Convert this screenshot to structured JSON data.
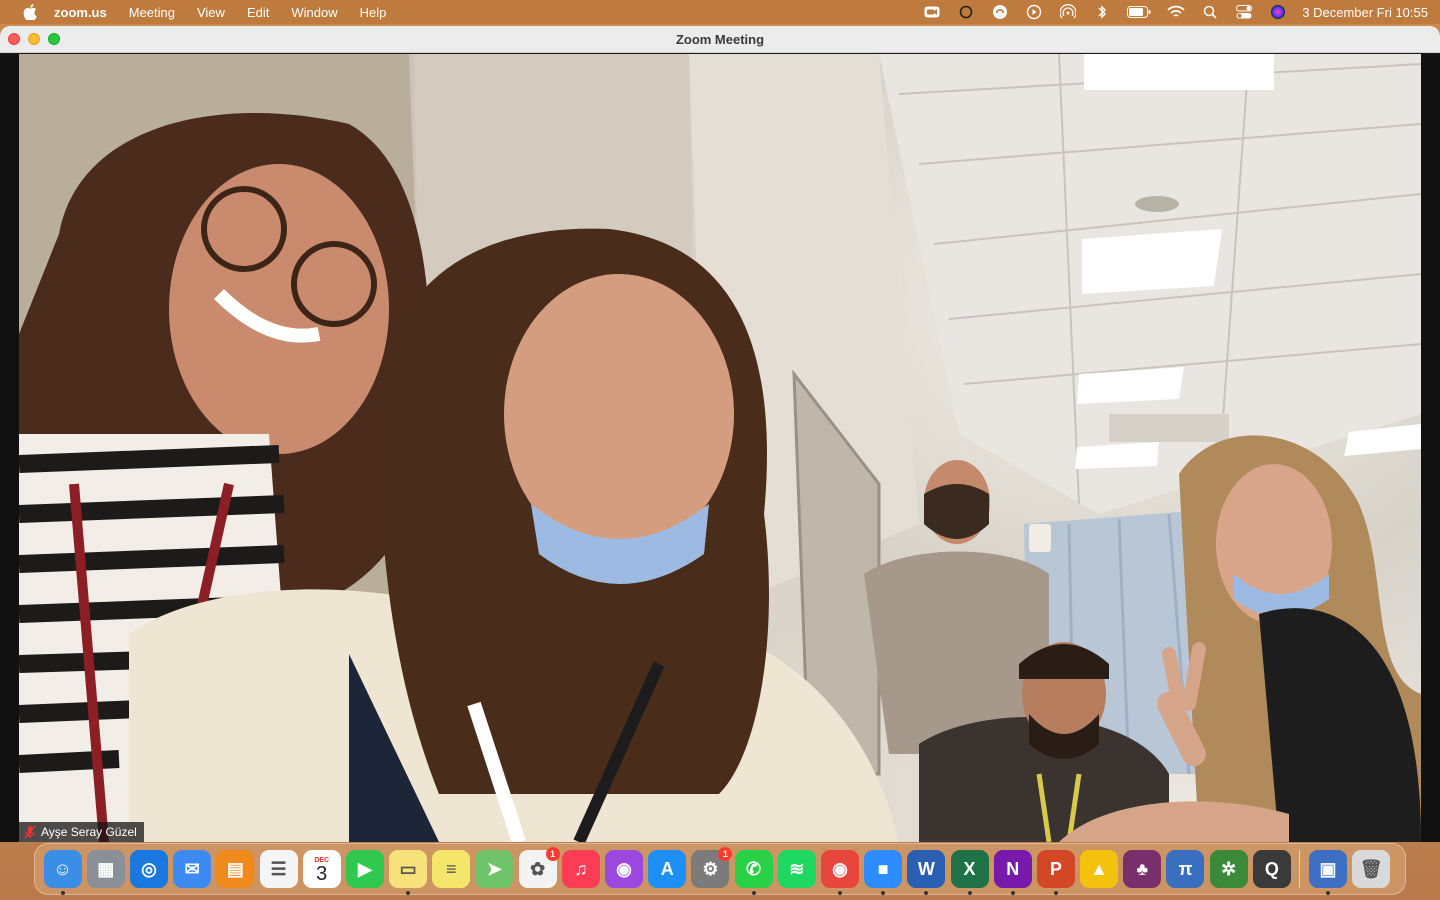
{
  "menubar": {
    "apple_icon": "apple-logo-icon",
    "items": [
      "zoom.us",
      "Meeting",
      "View",
      "Edit",
      "Window",
      "Help"
    ],
    "status_icons": [
      "zoom-video-icon",
      "circle-icon",
      "creative-cloud-icon",
      "play-icon",
      "airdrop-icon",
      "bluetooth-icon",
      "battery-icon",
      "wifi-icon",
      "search-icon",
      "control-center-icon",
      "siri-icon"
    ],
    "clock": "3 December Fri  10:55"
  },
  "window": {
    "title": "Zoom Meeting",
    "participant_name": "Ayşe Seray Güzel",
    "mic_icon": "mic-muted-icon"
  },
  "dock": {
    "items": [
      {
        "name": "finder",
        "color": "#3a8ee6",
        "glyph": "☺",
        "running": true
      },
      {
        "name": "launchpad",
        "color": "#8a8f98",
        "glyph": "▦",
        "running": false
      },
      {
        "name": "safari",
        "color": "#1b78e0",
        "glyph": "◎",
        "running": false
      },
      {
        "name": "mail",
        "color": "#3d8bf2",
        "glyph": "✉",
        "running": false
      },
      {
        "name": "books",
        "color": "#f08a1c",
        "glyph": "▤",
        "running": false
      },
      {
        "name": "reminders",
        "color": "#f5f5f5",
        "glyph": "☰",
        "running": false
      },
      {
        "name": "calendar",
        "color": "#ffffff",
        "month": "DEC",
        "day": "3",
        "running": false
      },
      {
        "name": "facetime",
        "color": "#2fc94f",
        "glyph": "▶",
        "running": false
      },
      {
        "name": "notes",
        "color": "#f7e27a",
        "glyph": "▭",
        "running": true
      },
      {
        "name": "stickies",
        "color": "#f4e56b",
        "glyph": "≡",
        "running": false
      },
      {
        "name": "maps",
        "color": "#6fc46a",
        "glyph": "➤",
        "running": false
      },
      {
        "name": "photos",
        "color": "#f3f3f3",
        "glyph": "✿",
        "badge": "1",
        "running": false
      },
      {
        "name": "music",
        "color": "#fa3c55",
        "glyph": "♫",
        "running": false
      },
      {
        "name": "podcasts",
        "color": "#9b47e0",
        "glyph": "◉",
        "running": false
      },
      {
        "name": "app-store",
        "color": "#1e8ff5",
        "glyph": "A",
        "running": false
      },
      {
        "name": "system-preferences",
        "color": "#7b7b7b",
        "glyph": "⚙",
        "badge": "1",
        "running": false
      },
      {
        "name": "whatsapp",
        "color": "#28d146",
        "glyph": "✆",
        "running": true
      },
      {
        "name": "spotify",
        "color": "#1ed760",
        "glyph": "≋",
        "running": false
      },
      {
        "name": "chrome",
        "color": "#e8453c",
        "glyph": "◉",
        "running": true
      },
      {
        "name": "zoom",
        "color": "#2d8cff",
        "glyph": "■",
        "running": true
      },
      {
        "name": "word",
        "color": "#2b5fb4",
        "glyph": "W",
        "running": true
      },
      {
        "name": "excel",
        "color": "#1e7245",
        "glyph": "X",
        "running": true
      },
      {
        "name": "onenote",
        "color": "#7719aa",
        "glyph": "N",
        "running": true
      },
      {
        "name": "powerpoint",
        "color": "#d24726",
        "glyph": "P",
        "running": true
      },
      {
        "name": "google-drive",
        "color": "#f4c20d",
        "glyph": "▲",
        "running": false
      },
      {
        "name": "tree-app",
        "color": "#7a2f6d",
        "glyph": "♣",
        "running": false
      },
      {
        "name": "mathtype",
        "color": "#3a6fc0",
        "glyph": "π",
        "running": false
      },
      {
        "name": "molecule-app",
        "color": "#3a8a3a",
        "glyph": "✲",
        "running": false
      },
      {
        "name": "quicktime",
        "color": "#3a3a3a",
        "glyph": "Q",
        "running": false
      },
      {
        "name": "preview",
        "color": "#3c6fc4",
        "glyph": "▣",
        "running": true
      },
      {
        "name": "trash",
        "color": "#d9d9d9",
        "glyph": "🗑",
        "running": false
      }
    ]
  }
}
